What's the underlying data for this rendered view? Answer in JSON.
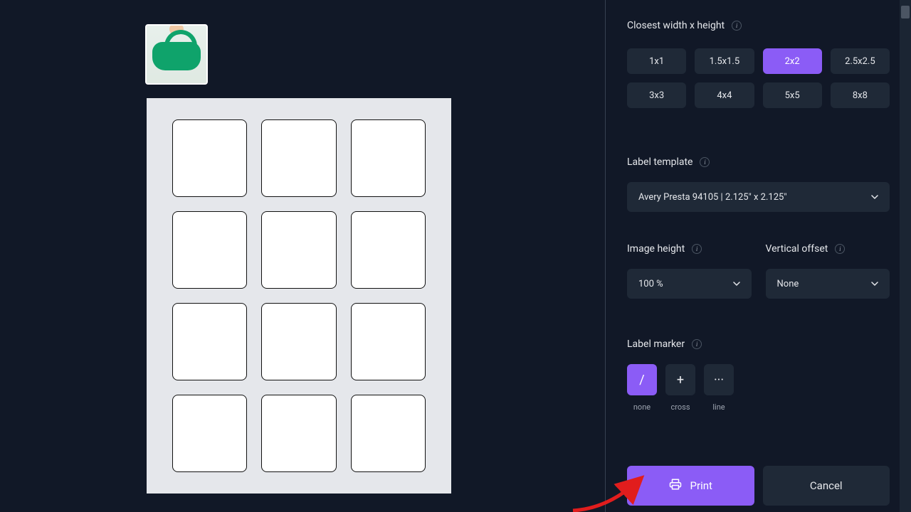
{
  "sizes": {
    "label": "Closest width x height",
    "options": [
      "1x1",
      "1.5x1.5",
      "2x2",
      "2.5x2.5",
      "3x3",
      "4x4",
      "5x5",
      "8x8"
    ],
    "selected": "2x2"
  },
  "template": {
    "label": "Label template",
    "value": "Avery Presta 94105 | 2.125\" x 2.125\""
  },
  "image_height": {
    "label": "Image height",
    "value": "100 %"
  },
  "vertical_offset": {
    "label": "Vertical offset",
    "value": "None"
  },
  "marker": {
    "label": "Label marker",
    "options": [
      {
        "symbol": "/",
        "caption": "none",
        "active": true
      },
      {
        "symbol": "+",
        "caption": "cross",
        "active": false
      },
      {
        "symbol": "···",
        "caption": "line",
        "active": false
      }
    ]
  },
  "actions": {
    "print": "Print",
    "cancel": "Cancel"
  }
}
